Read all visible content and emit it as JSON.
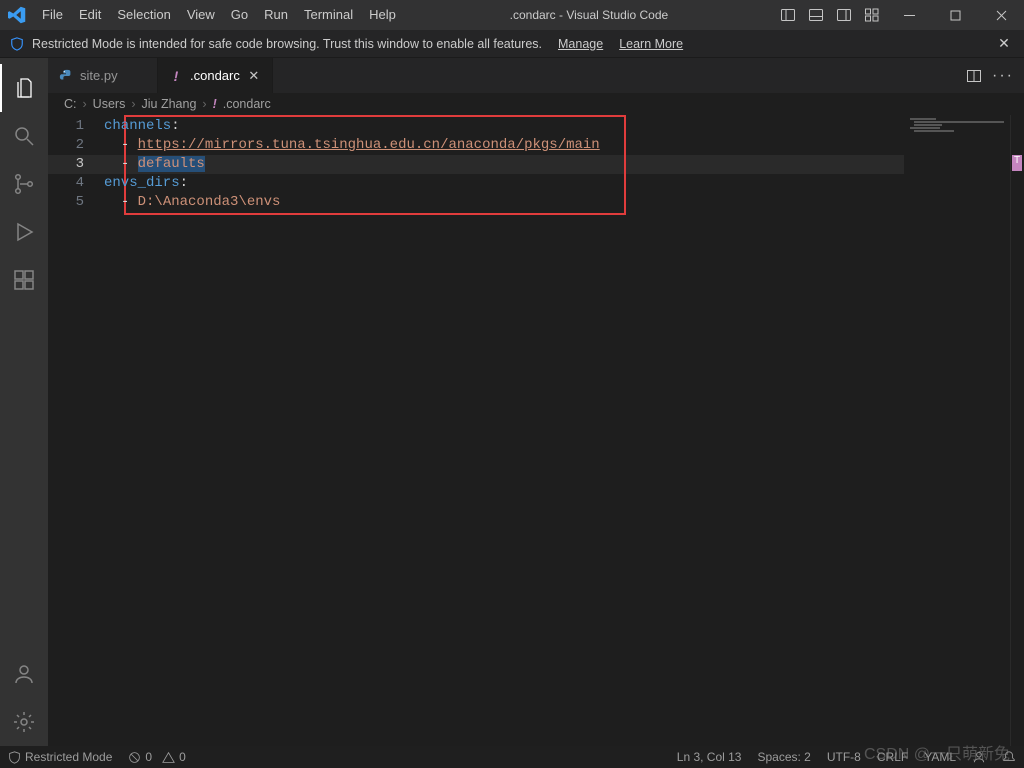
{
  "menu": [
    "File",
    "Edit",
    "Selection",
    "View",
    "Go",
    "Run",
    "Terminal",
    "Help"
  ],
  "window_title": ".condarc - Visual Studio Code",
  "restricted": {
    "message": "Restricted Mode is intended for safe code browsing. Trust this window to enable all features.",
    "manage": "Manage",
    "learn": "Learn More"
  },
  "tabs": [
    {
      "label": "site.py",
      "active": false,
      "icon": "python"
    },
    {
      "label": ".condarc",
      "active": true,
      "icon": "exclaim"
    }
  ],
  "breadcrumbs": {
    "root": "C:",
    "parts": [
      "Users",
      "Jiu Zhang"
    ],
    "file": ".condarc"
  },
  "editor": {
    "lines": [
      {
        "n": 1,
        "segments": [
          {
            "t": "channels",
            "c": "tok-key"
          },
          {
            "t": ":",
            "c": "tok-col"
          }
        ]
      },
      {
        "n": 2,
        "segments": [
          {
            "t": "  ",
            "c": ""
          },
          {
            "t": "- ",
            "c": "tok-dash"
          },
          {
            "t": "https://mirrors.tuna.tsinghua.edu.cn/anaconda/pkgs/main",
            "c": "tok-url"
          }
        ]
      },
      {
        "n": 3,
        "segments": [
          {
            "t": "  ",
            "c": ""
          },
          {
            "t": "- ",
            "c": "tok-dash"
          },
          {
            "t": "defaults",
            "c": "tok-str sel"
          }
        ],
        "current": true
      },
      {
        "n": 4,
        "segments": [
          {
            "t": "envs_dirs",
            "c": "tok-key"
          },
          {
            "t": ":",
            "c": "tok-col"
          }
        ]
      },
      {
        "n": 5,
        "segments": [
          {
            "t": "  ",
            "c": ""
          },
          {
            "t": "- ",
            "c": "tok-dash"
          },
          {
            "t": "D:\\Anaconda3\\envs",
            "c": "tok-plain"
          }
        ]
      }
    ]
  },
  "status": {
    "restricted": "Restricted Mode",
    "problems": "0",
    "warnings": "0",
    "lncol": "Ln 3, Col 13",
    "spaces": "Spaces: 2",
    "encoding": "UTF-8",
    "eol": "CRLF",
    "lang": "YAML"
  },
  "watermark": "CSDN @一只萌新兔"
}
